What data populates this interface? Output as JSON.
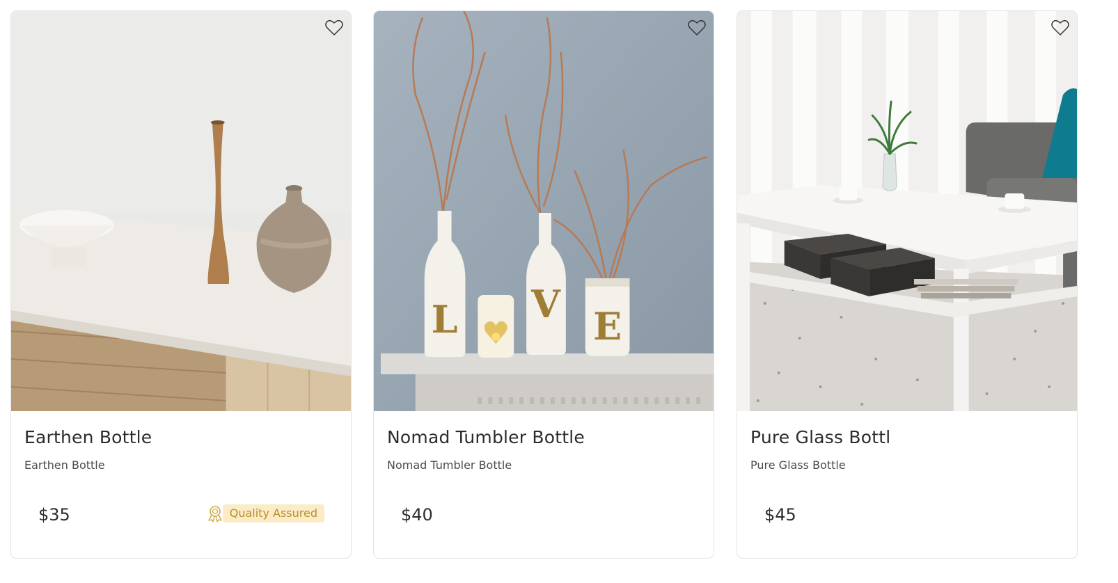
{
  "products": [
    {
      "title": "Earthen Bottle",
      "subtitle": "Earthen Bottle",
      "price": "$35",
      "badge": "Quality Assured",
      "image_name": "earthen-vessels-photo",
      "favorite_icon": "heart-outline-icon"
    },
    {
      "title": "Nomad Tumbler Bottle",
      "subtitle": "Nomad Tumbler Bottle",
      "price": "$40",
      "image_name": "love-bottles-photo",
      "favorite_icon": "heart-outline-icon"
    },
    {
      "title": "Pure Glass Bottl",
      "subtitle": "Pure Glass Bottle",
      "price": "$45",
      "image_name": "coffee-table-photo",
      "favorite_icon": "heart-outline-icon"
    }
  ],
  "colors": {
    "badge_bg": "#fbebc6",
    "badge_text": "#b8902a",
    "text_primary": "#2c2c2c",
    "card_border": "#e3e3e3"
  }
}
